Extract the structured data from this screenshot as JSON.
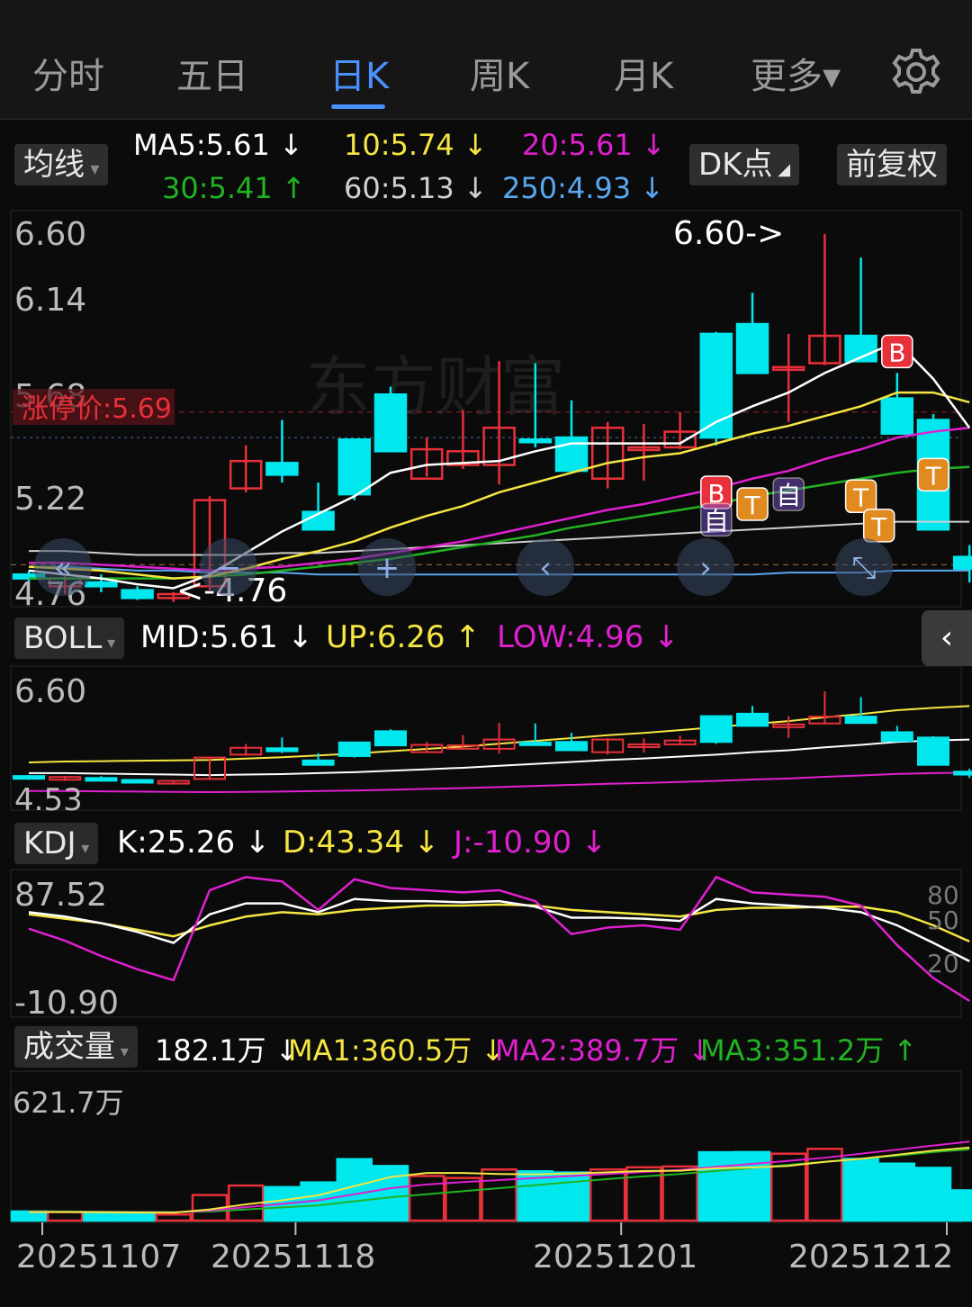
{
  "tabs": [
    {
      "label": "分时",
      "active": false
    },
    {
      "label": "五日",
      "active": false
    },
    {
      "label": "日K",
      "active": true
    },
    {
      "label": "周K",
      "active": false
    },
    {
      "label": "月K",
      "active": false
    },
    {
      "label": "更多▾",
      "active": false
    }
  ],
  "settings_icon": "gear-icon",
  "controls": {
    "ma_select": "均线",
    "dk_button": "DK点",
    "adjust_button": "前复权"
  },
  "ma": {
    "ma5": {
      "label": "MA5:5.61 ↓",
      "color": "#ffffff"
    },
    "ma10": {
      "label": "10:5.74 ↓",
      "color": "#f5e642"
    },
    "ma20": {
      "label": "20:5.61 ↓",
      "color": "#e020d0"
    },
    "ma30": {
      "label": "30:5.41 ↑",
      "color": "#22b322"
    },
    "ma60": {
      "label": "60:5.13 ↓",
      "color": "#d0d0d0"
    },
    "ma250": {
      "label": "250:4.93 ↓",
      "color": "#58a8f0"
    }
  },
  "main_chart": {
    "ymax_label": "6.60",
    "y_labels": [
      "6.60",
      "6.14",
      "5.68",
      "5.22",
      "4.76"
    ],
    "limit_up_label": "涨停价:5.69",
    "high_marker": "6.60->",
    "low_marker": "<-4.76",
    "watermark": "东方财富",
    "signals": [
      "B",
      "T",
      "自",
      "B",
      "T",
      "自",
      "T",
      "T"
    ]
  },
  "boll": {
    "select": "BOLL",
    "mid": "MID:5.61 ↓",
    "up": "UP:6.26 ↑",
    "low": "LOW:4.96 ↓",
    "y_top": "6.60",
    "y_bottom": "4.53"
  },
  "kdj": {
    "select": "KDJ",
    "k": "K:25.26 ↓",
    "d": "D:43.34 ↓",
    "j": "J:-10.90 ↓",
    "y_top": "87.52",
    "y_bottom": "-10.90",
    "ref_levels": [
      "80",
      "50",
      "20"
    ]
  },
  "volume": {
    "select": "成交量",
    "value": "182.1万 ↓",
    "ma1": "MA1:360.5万 ↓",
    "ma2": "MA2:389.7万 ↓",
    "ma3": "MA3:351.2万 ↑",
    "y_top": "621.7万"
  },
  "dates": [
    "20251107",
    "20251118",
    "20251201",
    "20251212"
  ],
  "colors": {
    "up": "#e8303a",
    "down": "#00e8ee",
    "accent": "#4a90ff",
    "background": "#0b0b0b"
  },
  "chart_data": {
    "type": "candlestick",
    "dates_shown": [
      "20251107",
      "20251118",
      "20251201",
      "20251212"
    ],
    "ohlc": [
      [
        4.86,
        4.88,
        4.78,
        4.84
      ],
      [
        4.84,
        4.86,
        4.76,
        4.8
      ],
      [
        4.82,
        4.86,
        4.77,
        4.8
      ],
      [
        4.78,
        4.8,
        4.73,
        4.74
      ],
      [
        4.74,
        4.77,
        4.72,
        4.76
      ],
      [
        4.8,
        5.26,
        4.78,
        5.24
      ],
      [
        5.3,
        5.52,
        5.28,
        5.44
      ],
      [
        5.43,
        5.65,
        5.33,
        5.37
      ],
      [
        5.18,
        5.33,
        5.12,
        5.09
      ],
      [
        5.27,
        5.55,
        5.24,
        5.55
      ],
      [
        5.78,
        5.82,
        5.51,
        5.49
      ],
      [
        5.5,
        5.56,
        5.36,
        5.35
      ],
      [
        5.49,
        5.7,
        5.4,
        5.42
      ],
      [
        5.42,
        5.95,
        5.32,
        5.61
      ],
      [
        5.55,
        5.94,
        5.51,
        5.55
      ],
      [
        5.56,
        5.75,
        5.4,
        5.39
      ],
      [
        5.35,
        5.64,
        5.3,
        5.61
      ],
      [
        5.51,
        5.63,
        5.34,
        5.51
      ],
      [
        5.51,
        5.69,
        5.5,
        5.59
      ],
      [
        5.56,
        6.1,
        5.52,
        6.09
      ],
      [
        6.14,
        6.3,
        5.89,
        5.89
      ],
      [
        5.92,
        6.09,
        5.64,
        5.92
      ],
      [
        6.08,
        6.6,
        5.93,
        5.94
      ],
      [
        6.08,
        6.48,
        5.98,
        5.95
      ],
      [
        5.76,
        5.89,
        5.62,
        5.58
      ],
      [
        5.65,
        5.68,
        5.12,
        5.09
      ],
      [
        4.95,
        5.01,
        4.82,
        4.89
      ]
    ],
    "candle_dir": [
      "down",
      "up",
      "down",
      "down",
      "up",
      "up",
      "up",
      "down",
      "down",
      "down",
      "down",
      "up",
      "up",
      "up",
      "down",
      "down",
      "up",
      "up",
      "up",
      "down",
      "down",
      "up",
      "up",
      "down",
      "down",
      "down",
      "down"
    ],
    "volume_wan": [
      45,
      42,
      40,
      38,
      30,
      126,
      173,
      165,
      188,
      303,
      269,
      220,
      210,
      252,
      243,
      237,
      252,
      263,
      267,
      337,
      338,
      330,
      354,
      304,
      281,
      260,
      149
    ],
    "boll": {
      "mid": 5.61,
      "up": 6.26,
      "low": 4.96
    },
    "kdj": {
      "k": 25.26,
      "d": 43.34,
      "j": -10.9
    },
    "volume_ma": {
      "ma1": 360.5,
      "ma2": 389.7,
      "ma3": 351.2
    }
  }
}
